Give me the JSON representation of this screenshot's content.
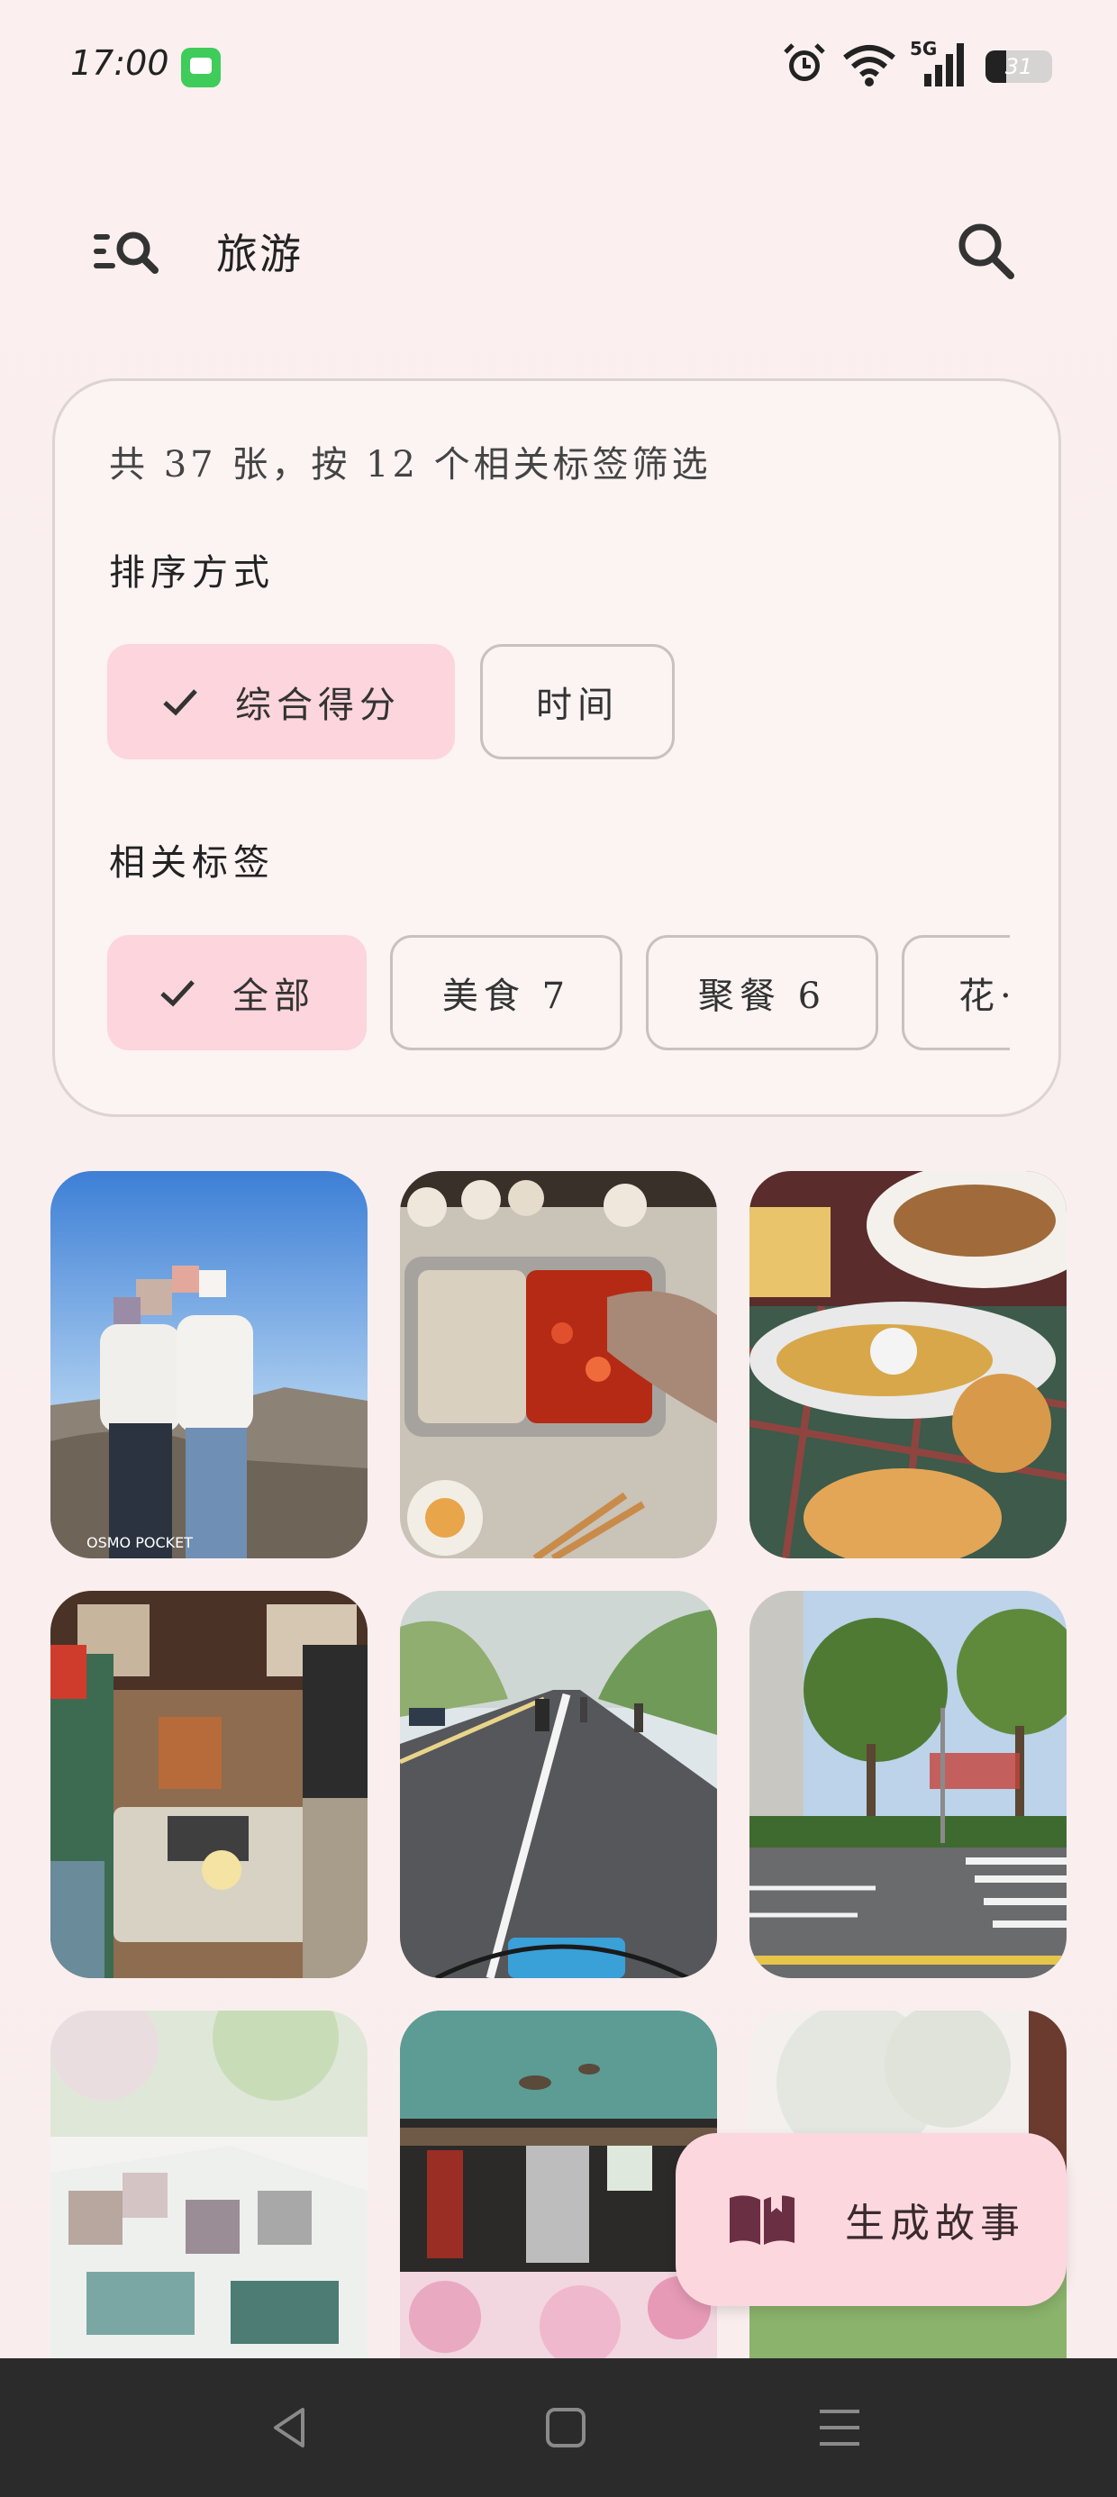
{
  "status": {
    "time": "17:00",
    "network": "5G",
    "battery": "31",
    "battery_level": 0.31
  },
  "header": {
    "title": "旅游"
  },
  "filter": {
    "summary": "共 37 张，按 12 个相关标签筛选",
    "sort_label": "排序方式",
    "sort_options": [
      {
        "label": "综合得分",
        "selected": true
      },
      {
        "label": "时间",
        "selected": false
      }
    ],
    "tags_label": "相关标签",
    "tags": [
      {
        "label": "全部",
        "selected": true
      },
      {
        "label": "美食 7",
        "selected": false
      },
      {
        "label": "聚餐 6",
        "selected": false
      },
      {
        "label": "花·",
        "selected": false
      }
    ]
  },
  "photos": [
    {
      "name": "mountain-couple-photo",
      "watermark": "OSMO POCKET"
    },
    {
      "name": "hotpot-photo"
    },
    {
      "name": "fried-food-photo"
    },
    {
      "name": "restaurant-group-photo"
    },
    {
      "name": "bike-road-photo"
    },
    {
      "name": "street-trees-photo"
    },
    {
      "name": "blossom-photo-collage"
    },
    {
      "name": "lake-pavilion-photo"
    },
    {
      "name": "cherry-blossom-photo"
    }
  ],
  "fab": {
    "label": "生成故事",
    "icon": "book-icon"
  },
  "nav": {
    "icons": [
      "back-icon",
      "home-icon",
      "menu-icon"
    ]
  },
  "colors": {
    "accent_chip": "#fdd5dc",
    "nav_bg": "#2b2b2b",
    "messages_green": "#3fcc5a"
  }
}
